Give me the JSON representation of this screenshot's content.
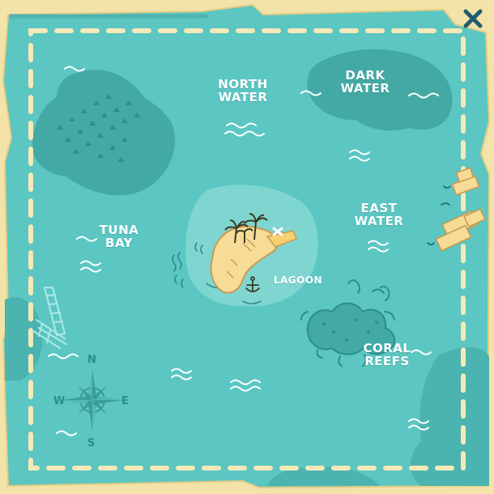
{
  "map": {
    "regions": {
      "north_water": "NORTH\nWATER",
      "dark_water": "DARK\nWATER",
      "tuna_bay": "TUNA\nBAY",
      "east_water": "EAST\nWATER",
      "lagoon": "LAGOON",
      "coral_reefs": "CORAL\nREEFS"
    },
    "compass": {
      "north": "N",
      "south": "S",
      "east": "E",
      "west": "W"
    }
  },
  "controls": {
    "close_icon": "close-icon"
  },
  "colors": {
    "parchment": "#f3e3a8",
    "sea": "#5bc6c2",
    "sea_light": "#7fd6d1",
    "sea_dark": "#43a9a5",
    "dash": "#f5e9b8",
    "island_sand": "#f6dc96",
    "ink": "#1f5d6b"
  }
}
